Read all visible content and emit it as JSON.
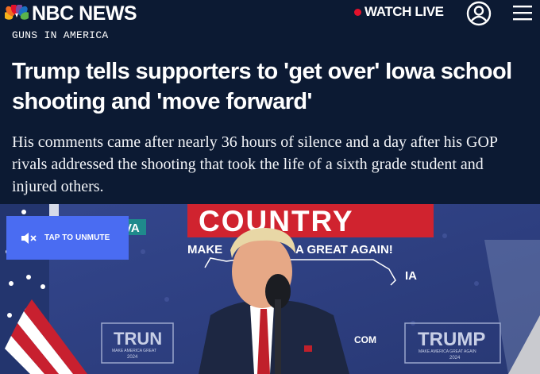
{
  "header": {
    "brand": "NBC NEWS",
    "watch_live_label": "WATCH LIVE",
    "colors": {
      "background": "#0c1a33",
      "live_dot": "#e4112b"
    }
  },
  "article": {
    "kicker": "GUNS IN AMERICA",
    "headline": "Trump tells supporters to 'get over' Iowa school shooting and 'move forward'",
    "dek": "His comments came after nearly 36 hours of silence and a day after his GOP rivals addressed the shooting that took the life of a sixth grade student and injured others."
  },
  "video": {
    "unmute_label": "TAP TO UNMUTE",
    "unmute_color": "#4a6cf2",
    "backdrop_text": {
      "banner_top": "COUNTRY",
      "banner_slogan_left": "MAKE",
      "banner_slogan_right": "A GREAT AGAIN!",
      "banner_fragment": "IA",
      "sign_left_tag": "VA",
      "sign_left": "TRUN",
      "sign_left_sub": "MAKE AMERICA GREAT",
      "sign_left_year": "2024",
      "sign_right": "TRUMP",
      "sign_right_sub": "MAKE AMERICA GREAT AGAIN",
      "sign_right_year": "2024",
      "sign_url": "COM"
    }
  },
  "icons": {
    "account": "user-circle-icon",
    "menu": "hamburger-menu-icon",
    "mute": "speaker-muted-icon",
    "logo": "peacock-icon"
  }
}
